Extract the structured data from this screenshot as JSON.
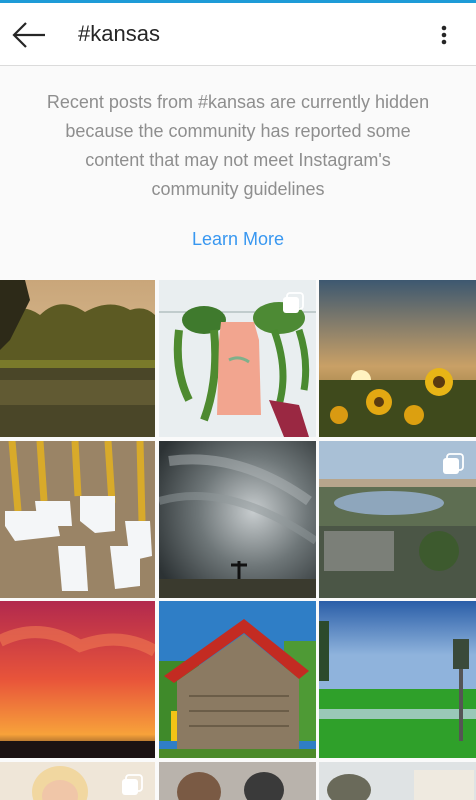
{
  "header": {
    "title": "#kansas",
    "back_icon": "arrow-left-icon",
    "more_icon": "vertical-ellipsis-icon"
  },
  "notice": {
    "text": "Recent posts from #kansas are currently hidden because the community has reported some content that may not meet Instagram's community guidelines",
    "link_label": "Learn More"
  },
  "colors": {
    "accent_top_line": "#1e9bd7",
    "link": "#3897f0",
    "notice_text": "#8e8e8e",
    "background": "#fafafa"
  },
  "grid": {
    "posts": [
      {
        "subject": "pond with trees at sunset",
        "multi": false
      },
      {
        "subject": "hanging plants with pink tank top",
        "multi": true
      },
      {
        "subject": "sunflower field at sunset",
        "multi": false
      },
      {
        "subject": "state-shaped ornaments with gold ribbons on burlap",
        "multi": false
      },
      {
        "subject": "storm clouds over prairie with person",
        "multi": false
      },
      {
        "subject": "aerial view of crowd near lake and city",
        "multi": true
      },
      {
        "subject": "red orange sunset sky",
        "multi": false
      },
      {
        "subject": "old wooden barn with red roof",
        "multi": false
      },
      {
        "subject": "green field under blue sky",
        "multi": false
      },
      {
        "subject": "smiling woman",
        "multi": true
      },
      {
        "subject": "group of people",
        "multi": false
      },
      {
        "subject": "people outdoors near building",
        "multi": false
      }
    ]
  }
}
